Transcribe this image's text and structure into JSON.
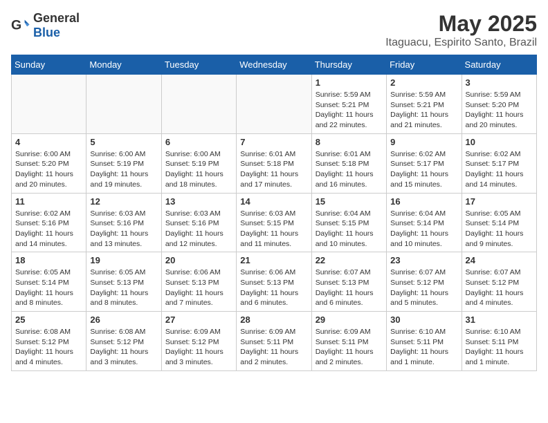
{
  "header": {
    "logo_general": "General",
    "logo_blue": "Blue",
    "title": "May 2025",
    "subtitle": "Itaguacu, Espirito Santo, Brazil"
  },
  "days_of_week": [
    "Sunday",
    "Monday",
    "Tuesday",
    "Wednesday",
    "Thursday",
    "Friday",
    "Saturday"
  ],
  "weeks": [
    {
      "days": [
        {
          "number": "",
          "empty": true
        },
        {
          "number": "",
          "empty": true
        },
        {
          "number": "",
          "empty": true
        },
        {
          "number": "",
          "empty": true
        },
        {
          "number": "1",
          "sunrise": "Sunrise: 5:59 AM",
          "sunset": "Sunset: 5:21 PM",
          "daylight": "Daylight: 11 hours and 22 minutes."
        },
        {
          "number": "2",
          "sunrise": "Sunrise: 5:59 AM",
          "sunset": "Sunset: 5:21 PM",
          "daylight": "Daylight: 11 hours and 21 minutes."
        },
        {
          "number": "3",
          "sunrise": "Sunrise: 5:59 AM",
          "sunset": "Sunset: 5:20 PM",
          "daylight": "Daylight: 11 hours and 20 minutes."
        }
      ]
    },
    {
      "days": [
        {
          "number": "4",
          "sunrise": "Sunrise: 6:00 AM",
          "sunset": "Sunset: 5:20 PM",
          "daylight": "Daylight: 11 hours and 20 minutes."
        },
        {
          "number": "5",
          "sunrise": "Sunrise: 6:00 AM",
          "sunset": "Sunset: 5:19 PM",
          "daylight": "Daylight: 11 hours and 19 minutes."
        },
        {
          "number": "6",
          "sunrise": "Sunrise: 6:00 AM",
          "sunset": "Sunset: 5:19 PM",
          "daylight": "Daylight: 11 hours and 18 minutes."
        },
        {
          "number": "7",
          "sunrise": "Sunrise: 6:01 AM",
          "sunset": "Sunset: 5:18 PM",
          "daylight": "Daylight: 11 hours and 17 minutes."
        },
        {
          "number": "8",
          "sunrise": "Sunrise: 6:01 AM",
          "sunset": "Sunset: 5:18 PM",
          "daylight": "Daylight: 11 hours and 16 minutes."
        },
        {
          "number": "9",
          "sunrise": "Sunrise: 6:02 AM",
          "sunset": "Sunset: 5:17 PM",
          "daylight": "Daylight: 11 hours and 15 minutes."
        },
        {
          "number": "10",
          "sunrise": "Sunrise: 6:02 AM",
          "sunset": "Sunset: 5:17 PM",
          "daylight": "Daylight: 11 hours and 14 minutes."
        }
      ]
    },
    {
      "days": [
        {
          "number": "11",
          "sunrise": "Sunrise: 6:02 AM",
          "sunset": "Sunset: 5:16 PM",
          "daylight": "Daylight: 11 hours and 14 minutes."
        },
        {
          "number": "12",
          "sunrise": "Sunrise: 6:03 AM",
          "sunset": "Sunset: 5:16 PM",
          "daylight": "Daylight: 11 hours and 13 minutes."
        },
        {
          "number": "13",
          "sunrise": "Sunrise: 6:03 AM",
          "sunset": "Sunset: 5:16 PM",
          "daylight": "Daylight: 11 hours and 12 minutes."
        },
        {
          "number": "14",
          "sunrise": "Sunrise: 6:03 AM",
          "sunset": "Sunset: 5:15 PM",
          "daylight": "Daylight: 11 hours and 11 minutes."
        },
        {
          "number": "15",
          "sunrise": "Sunrise: 6:04 AM",
          "sunset": "Sunset: 5:15 PM",
          "daylight": "Daylight: 11 hours and 10 minutes."
        },
        {
          "number": "16",
          "sunrise": "Sunrise: 6:04 AM",
          "sunset": "Sunset: 5:14 PM",
          "daylight": "Daylight: 11 hours and 10 minutes."
        },
        {
          "number": "17",
          "sunrise": "Sunrise: 6:05 AM",
          "sunset": "Sunset: 5:14 PM",
          "daylight": "Daylight: 11 hours and 9 minutes."
        }
      ]
    },
    {
      "days": [
        {
          "number": "18",
          "sunrise": "Sunrise: 6:05 AM",
          "sunset": "Sunset: 5:14 PM",
          "daylight": "Daylight: 11 hours and 8 minutes."
        },
        {
          "number": "19",
          "sunrise": "Sunrise: 6:05 AM",
          "sunset": "Sunset: 5:13 PM",
          "daylight": "Daylight: 11 hours and 8 minutes."
        },
        {
          "number": "20",
          "sunrise": "Sunrise: 6:06 AM",
          "sunset": "Sunset: 5:13 PM",
          "daylight": "Daylight: 11 hours and 7 minutes."
        },
        {
          "number": "21",
          "sunrise": "Sunrise: 6:06 AM",
          "sunset": "Sunset: 5:13 PM",
          "daylight": "Daylight: 11 hours and 6 minutes."
        },
        {
          "number": "22",
          "sunrise": "Sunrise: 6:07 AM",
          "sunset": "Sunset: 5:13 PM",
          "daylight": "Daylight: 11 hours and 6 minutes."
        },
        {
          "number": "23",
          "sunrise": "Sunrise: 6:07 AM",
          "sunset": "Sunset: 5:12 PM",
          "daylight": "Daylight: 11 hours and 5 minutes."
        },
        {
          "number": "24",
          "sunrise": "Sunrise: 6:07 AM",
          "sunset": "Sunset: 5:12 PM",
          "daylight": "Daylight: 11 hours and 4 minutes."
        }
      ]
    },
    {
      "days": [
        {
          "number": "25",
          "sunrise": "Sunrise: 6:08 AM",
          "sunset": "Sunset: 5:12 PM",
          "daylight": "Daylight: 11 hours and 4 minutes."
        },
        {
          "number": "26",
          "sunrise": "Sunrise: 6:08 AM",
          "sunset": "Sunset: 5:12 PM",
          "daylight": "Daylight: 11 hours and 3 minutes."
        },
        {
          "number": "27",
          "sunrise": "Sunrise: 6:09 AM",
          "sunset": "Sunset: 5:12 PM",
          "daylight": "Daylight: 11 hours and 3 minutes."
        },
        {
          "number": "28",
          "sunrise": "Sunrise: 6:09 AM",
          "sunset": "Sunset: 5:11 PM",
          "daylight": "Daylight: 11 hours and 2 minutes."
        },
        {
          "number": "29",
          "sunrise": "Sunrise: 6:09 AM",
          "sunset": "Sunset: 5:11 PM",
          "daylight": "Daylight: 11 hours and 2 minutes."
        },
        {
          "number": "30",
          "sunrise": "Sunrise: 6:10 AM",
          "sunset": "Sunset: 5:11 PM",
          "daylight": "Daylight: 11 hours and 1 minute."
        },
        {
          "number": "31",
          "sunrise": "Sunrise: 6:10 AM",
          "sunset": "Sunset: 5:11 PM",
          "daylight": "Daylight: 11 hours and 1 minute."
        }
      ]
    }
  ]
}
